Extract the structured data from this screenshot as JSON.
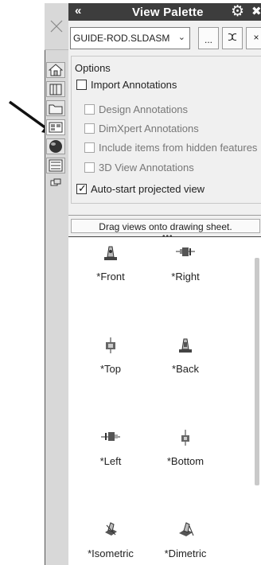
{
  "pointer": {
    "icon": "callout-arrow"
  },
  "tab_strip": {
    "close_icon": "close-x-icon",
    "tabs": [
      {
        "name": "tab-solidworks-resources",
        "icon": "home-icon"
      },
      {
        "name": "tab-design-library",
        "icon": "library-icon"
      },
      {
        "name": "tab-file-explorer",
        "icon": "folder-icon"
      },
      {
        "name": "tab-view-palette",
        "icon": "view-palette-icon"
      },
      {
        "name": "tab-appearances",
        "icon": "sphere-icon"
      },
      {
        "name": "tab-custom-properties",
        "icon": "properties-icon"
      },
      {
        "name": "tab-extra",
        "icon": "small-tab-icon"
      }
    ]
  },
  "panel": {
    "title": "View Palette",
    "collapse_glyph": "«",
    "doc_select": {
      "value": "GUIDE-ROD.SLDASM"
    },
    "browse_label": "...",
    "refresh_glyph": "ⵋ",
    "close_glyph": "×"
  },
  "options": {
    "label": "Options",
    "import_annotations": {
      "label": "Import Annotations",
      "checked": false
    },
    "design_annotations": {
      "label": "Design Annotations",
      "checked": false
    },
    "dimxpert_annotations": {
      "label": "DimXpert Annotations",
      "checked": false
    },
    "include_hidden": {
      "label": "Include items from hidden features",
      "checked": false
    },
    "view_3d_annotations": {
      "label": "3D View Annotations",
      "checked": false
    },
    "auto_start": {
      "label": "Auto-start projected view",
      "checked": true
    }
  },
  "drag_hint": "Drag views onto drawing sheet.",
  "grip": "•••",
  "views": [
    {
      "label": "*Front"
    },
    {
      "label": "*Right"
    },
    {
      "label": "*Top"
    },
    {
      "label": "*Back"
    },
    {
      "label": "*Left"
    },
    {
      "label": "*Bottom"
    },
    {
      "label": "*Isometric"
    },
    {
      "label": "*Dimetric"
    }
  ]
}
